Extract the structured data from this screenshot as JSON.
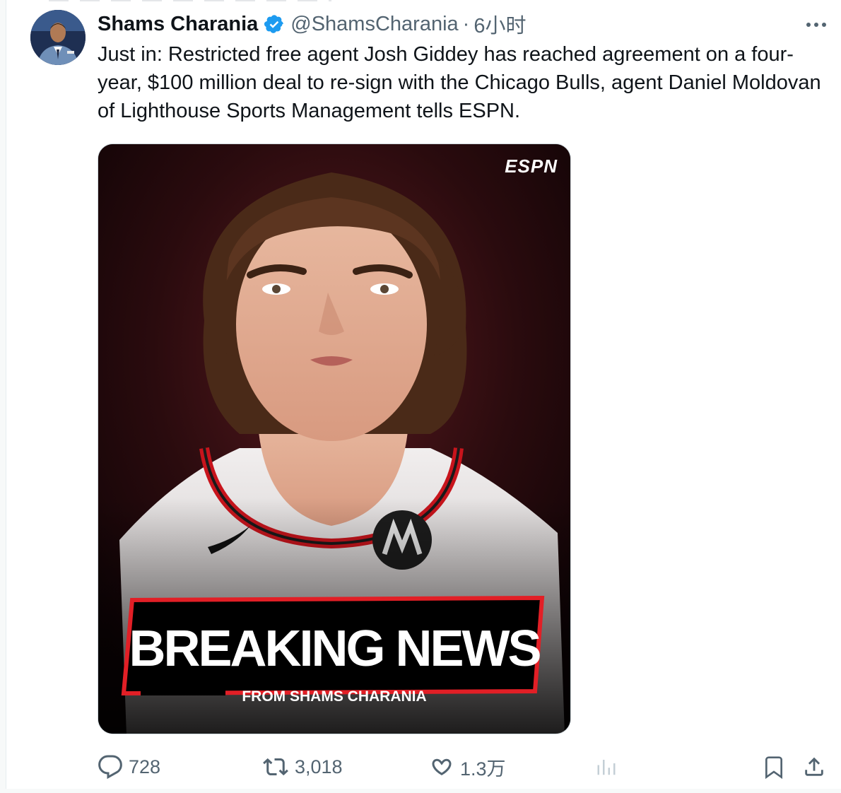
{
  "tweet": {
    "author": {
      "display_name": "Shams Charania",
      "handle": "@ShamsCharania",
      "verified_icon": "verified-badge-icon",
      "verified_color": "#1d9bf0",
      "avatar_icon": "avatar"
    },
    "separator": "·",
    "time": "6小时",
    "text": "Just in: Restricted free agent Josh Giddey has reached agreement on a four-year, $100 million deal to re-sign with the Chicago Bulls, agent Daniel Moldovan of Lighthouse Sports Management tells ESPN.",
    "media": {
      "logo": "ESPN",
      "banner_title": "BREAKING NEWS",
      "banner_subtitle": "FROM SHAMS CHARANIA",
      "accent_color": "#e21f26"
    },
    "actions": {
      "reply_count": "728",
      "retweet_count": "3,018",
      "like_count": "1.3万",
      "icons": [
        "reply-icon",
        "retweet-icon",
        "like-icon",
        "views-icon",
        "bookmark-icon",
        "share-icon"
      ]
    }
  }
}
